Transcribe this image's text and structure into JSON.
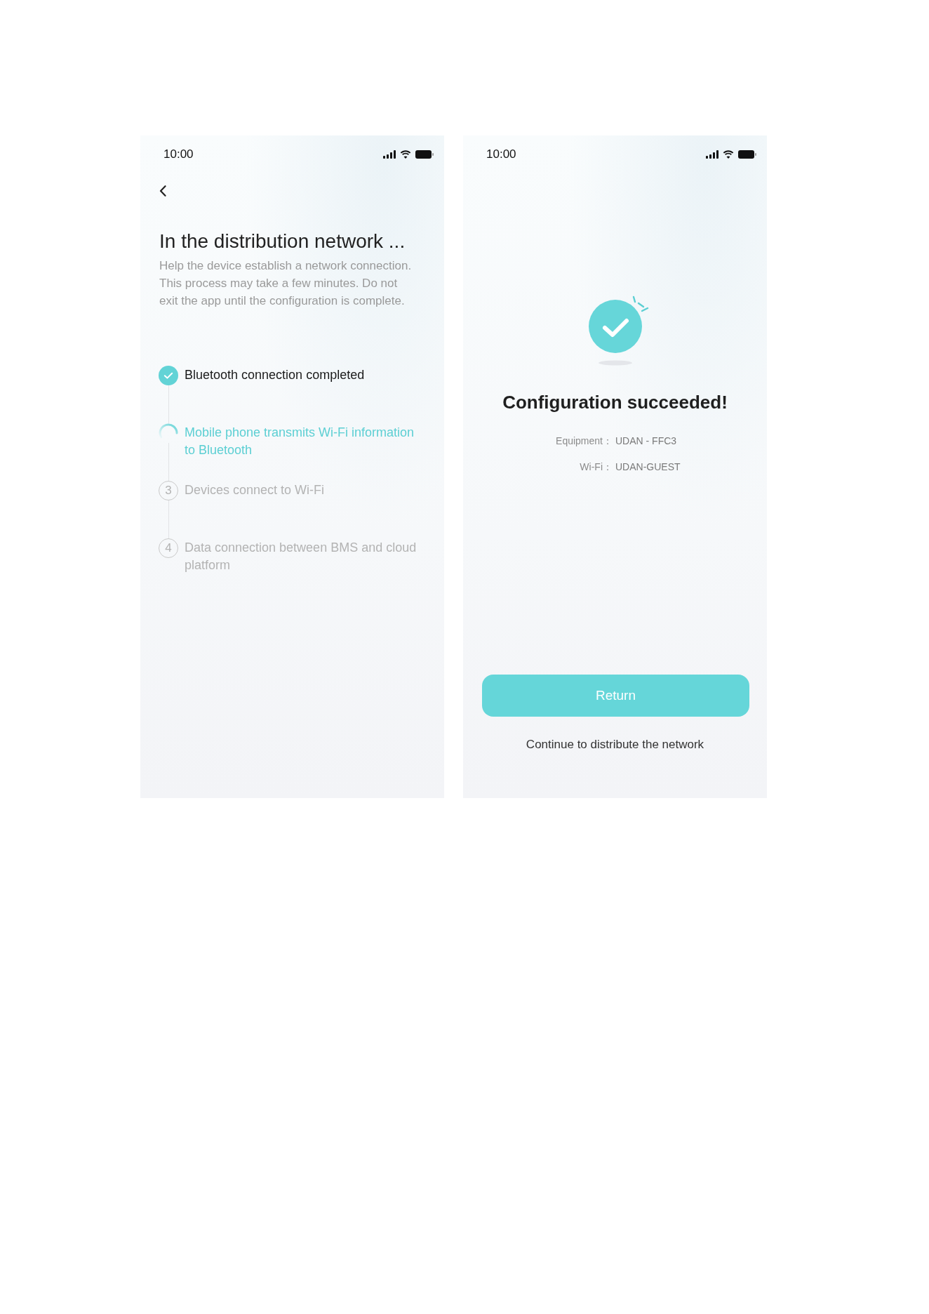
{
  "screens": [
    {
      "kind": "progress",
      "status_bar": {
        "time": "10:00"
      },
      "title": "In the distribution network ...",
      "description": "Help the device establish a network connection. This process may take a few minutes. Do not exit the app until the configuration is complete.",
      "steps": [
        {
          "kind": "done",
          "label": "Bluetooth connection completed"
        },
        {
          "kind": "active",
          "label": "Mobile phone transmits Wi-Fi information to Bluetooth"
        },
        {
          "kind": "pending",
          "number": "3",
          "label": "Devices connect to Wi-Fi"
        },
        {
          "kind": "pending",
          "number": "4",
          "label": "Data connection between BMS and cloud platform"
        }
      ]
    },
    {
      "kind": "result",
      "status_bar": {
        "time": "10:00"
      },
      "title": "Configuration succeeded!",
      "details": [
        {
          "label": "Equipment：",
          "value": "UDAN - FFC3"
        },
        {
          "label": "Wi-Fi：",
          "value": "UDAN-GUEST"
        }
      ],
      "button": "Return",
      "link": "Continue to distribute the network"
    }
  ]
}
